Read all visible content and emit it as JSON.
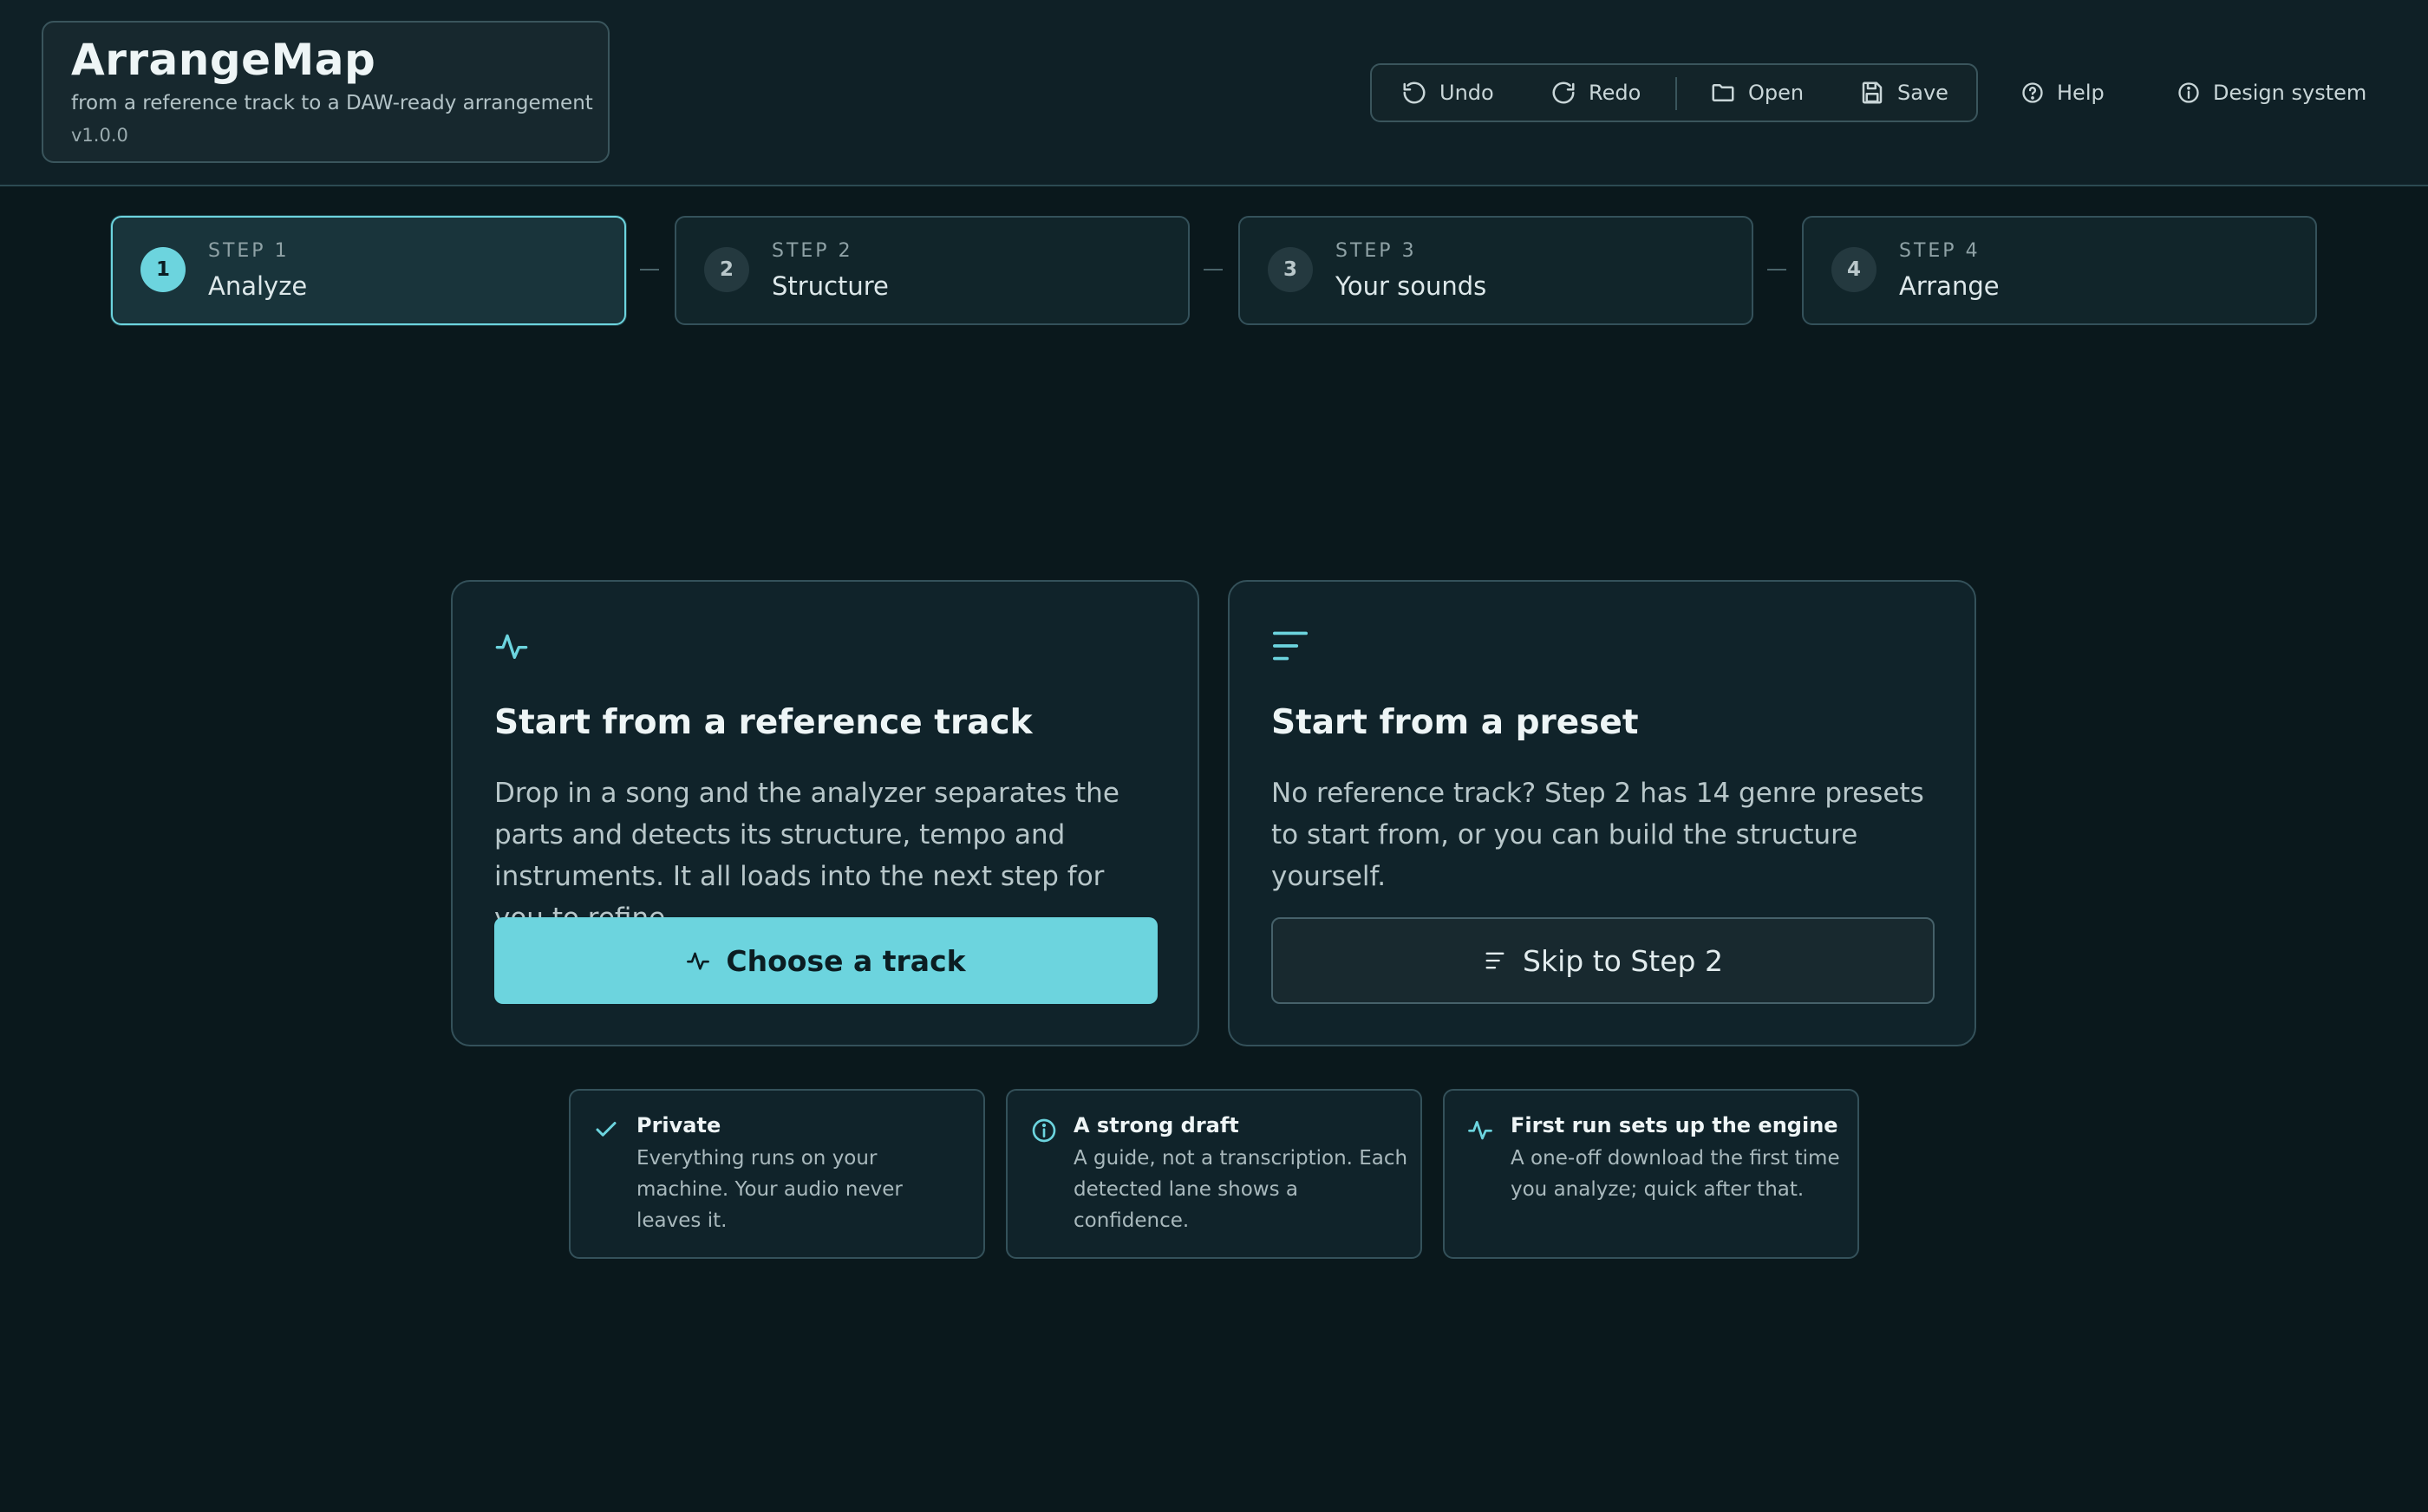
{
  "app": {
    "name": "ArrangeMap",
    "tagline": "from a reference track to a DAW-ready arrangement",
    "version": "v1.0.0"
  },
  "toolbar": {
    "undo": "Undo",
    "redo": "Redo",
    "open": "Open",
    "save": "Save"
  },
  "header_links": {
    "help": "Help",
    "design_system": "Design system"
  },
  "steps": [
    {
      "number": "1",
      "kicker": "STEP 1",
      "title": "Analyze",
      "active": true
    },
    {
      "number": "2",
      "kicker": "STEP 2",
      "title": "Structure",
      "active": false
    },
    {
      "number": "3",
      "kicker": "STEP 3",
      "title": "Your sounds",
      "active": false
    },
    {
      "number": "4",
      "kicker": "STEP 4",
      "title": "Arrange",
      "active": false
    }
  ],
  "cards": {
    "reference": {
      "icon": "waveform-icon",
      "title": "Start from a reference track",
      "text": "Drop in a song and the analyzer separates the parts and detects its structure, tempo and instruments. It all loads into the next step for you to refine.",
      "button": "Choose a track"
    },
    "preset": {
      "icon": "list-lines-icon",
      "title": "Start from a preset",
      "text": "No reference track? Step 2 has 14 genre presets to start from, or you can build the structure yourself.",
      "button": "Skip to Step 2"
    }
  },
  "info": [
    {
      "icon": "check-icon",
      "title": "Private",
      "text": "Everything runs on your machine. Your audio never leaves it."
    },
    {
      "icon": "info-icon",
      "title": "A strong draft",
      "text": "A guide, not a transcription. Each detected lane shows a confidence."
    },
    {
      "icon": "waveform-icon",
      "title": "First run sets up the engine",
      "text": "A one-off download the first time you analyze; quick after that."
    }
  ],
  "colors": {
    "accent": "#6cd4de",
    "background": "#0a181c",
    "surface": "#10232a",
    "border": "#34515a"
  }
}
